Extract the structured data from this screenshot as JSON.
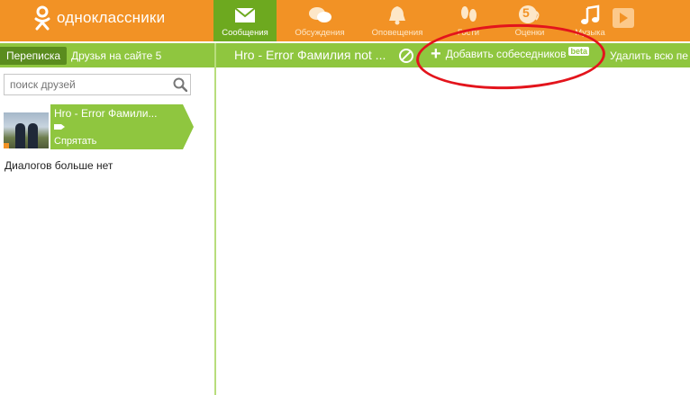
{
  "topbar": {
    "logo_text": "одноклассники",
    "nav": [
      {
        "label": "Сообщения",
        "icon": "envelope-icon",
        "active": true
      },
      {
        "label": "Обсуждения",
        "icon": "chat-bubbles-icon",
        "active": false
      },
      {
        "label": "Оповещения",
        "icon": "bell-icon",
        "active": false
      },
      {
        "label": "Гости",
        "icon": "footprints-icon",
        "active": false
      },
      {
        "label": "Оценки",
        "icon": "rating-5-icon",
        "badge": "5",
        "active": false
      },
      {
        "label": "Музыка",
        "icon": "music-note-icon",
        "active": false
      }
    ],
    "play_icon": "play-icon"
  },
  "subbar": {
    "tab_active": "Переписка",
    "tab_friends": "Друзья на сайте 5",
    "chat_title": "Hro - Error Фамилия not ...",
    "add_label": "Добавить собеседников",
    "beta": "beta",
    "delete_all": "Удалить всю пе"
  },
  "sidebar": {
    "search_placeholder": "поиск друзей",
    "contact": {
      "name": "Hro - Error Фамили...",
      "hide_label": "Спрятать"
    },
    "no_more": "Диалогов больше нет"
  },
  "colors": {
    "orange": "#f29225",
    "green": "#8fc63f",
    "dark_green": "#5a8c1e",
    "annotation_red": "#e3141c"
  }
}
